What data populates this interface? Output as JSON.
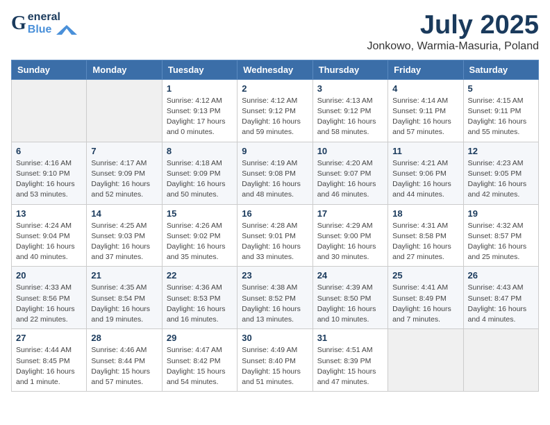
{
  "header": {
    "logo_g": "G",
    "logo_eneral": "eneral",
    "logo_blue": "Blue",
    "month_title": "July 2025",
    "subtitle": "Jonkowo, Warmia-Masuria, Poland"
  },
  "weekdays": [
    "Sunday",
    "Monday",
    "Tuesday",
    "Wednesday",
    "Thursday",
    "Friday",
    "Saturday"
  ],
  "weeks": [
    [
      {
        "day": "",
        "info": ""
      },
      {
        "day": "",
        "info": ""
      },
      {
        "day": "1",
        "info": "Sunrise: 4:12 AM\nSunset: 9:13 PM\nDaylight: 17 hours\nand 0 minutes."
      },
      {
        "day": "2",
        "info": "Sunrise: 4:12 AM\nSunset: 9:12 PM\nDaylight: 16 hours\nand 59 minutes."
      },
      {
        "day": "3",
        "info": "Sunrise: 4:13 AM\nSunset: 9:12 PM\nDaylight: 16 hours\nand 58 minutes."
      },
      {
        "day": "4",
        "info": "Sunrise: 4:14 AM\nSunset: 9:11 PM\nDaylight: 16 hours\nand 57 minutes."
      },
      {
        "day": "5",
        "info": "Sunrise: 4:15 AM\nSunset: 9:11 PM\nDaylight: 16 hours\nand 55 minutes."
      }
    ],
    [
      {
        "day": "6",
        "info": "Sunrise: 4:16 AM\nSunset: 9:10 PM\nDaylight: 16 hours\nand 53 minutes."
      },
      {
        "day": "7",
        "info": "Sunrise: 4:17 AM\nSunset: 9:09 PM\nDaylight: 16 hours\nand 52 minutes."
      },
      {
        "day": "8",
        "info": "Sunrise: 4:18 AM\nSunset: 9:09 PM\nDaylight: 16 hours\nand 50 minutes."
      },
      {
        "day": "9",
        "info": "Sunrise: 4:19 AM\nSunset: 9:08 PM\nDaylight: 16 hours\nand 48 minutes."
      },
      {
        "day": "10",
        "info": "Sunrise: 4:20 AM\nSunset: 9:07 PM\nDaylight: 16 hours\nand 46 minutes."
      },
      {
        "day": "11",
        "info": "Sunrise: 4:21 AM\nSunset: 9:06 PM\nDaylight: 16 hours\nand 44 minutes."
      },
      {
        "day": "12",
        "info": "Sunrise: 4:23 AM\nSunset: 9:05 PM\nDaylight: 16 hours\nand 42 minutes."
      }
    ],
    [
      {
        "day": "13",
        "info": "Sunrise: 4:24 AM\nSunset: 9:04 PM\nDaylight: 16 hours\nand 40 minutes."
      },
      {
        "day": "14",
        "info": "Sunrise: 4:25 AM\nSunset: 9:03 PM\nDaylight: 16 hours\nand 37 minutes."
      },
      {
        "day": "15",
        "info": "Sunrise: 4:26 AM\nSunset: 9:02 PM\nDaylight: 16 hours\nand 35 minutes."
      },
      {
        "day": "16",
        "info": "Sunrise: 4:28 AM\nSunset: 9:01 PM\nDaylight: 16 hours\nand 33 minutes."
      },
      {
        "day": "17",
        "info": "Sunrise: 4:29 AM\nSunset: 9:00 PM\nDaylight: 16 hours\nand 30 minutes."
      },
      {
        "day": "18",
        "info": "Sunrise: 4:31 AM\nSunset: 8:58 PM\nDaylight: 16 hours\nand 27 minutes."
      },
      {
        "day": "19",
        "info": "Sunrise: 4:32 AM\nSunset: 8:57 PM\nDaylight: 16 hours\nand 25 minutes."
      }
    ],
    [
      {
        "day": "20",
        "info": "Sunrise: 4:33 AM\nSunset: 8:56 PM\nDaylight: 16 hours\nand 22 minutes."
      },
      {
        "day": "21",
        "info": "Sunrise: 4:35 AM\nSunset: 8:54 PM\nDaylight: 16 hours\nand 19 minutes."
      },
      {
        "day": "22",
        "info": "Sunrise: 4:36 AM\nSunset: 8:53 PM\nDaylight: 16 hours\nand 16 minutes."
      },
      {
        "day": "23",
        "info": "Sunrise: 4:38 AM\nSunset: 8:52 PM\nDaylight: 16 hours\nand 13 minutes."
      },
      {
        "day": "24",
        "info": "Sunrise: 4:39 AM\nSunset: 8:50 PM\nDaylight: 16 hours\nand 10 minutes."
      },
      {
        "day": "25",
        "info": "Sunrise: 4:41 AM\nSunset: 8:49 PM\nDaylight: 16 hours\nand 7 minutes."
      },
      {
        "day": "26",
        "info": "Sunrise: 4:43 AM\nSunset: 8:47 PM\nDaylight: 16 hours\nand 4 minutes."
      }
    ],
    [
      {
        "day": "27",
        "info": "Sunrise: 4:44 AM\nSunset: 8:45 PM\nDaylight: 16 hours\nand 1 minute."
      },
      {
        "day": "28",
        "info": "Sunrise: 4:46 AM\nSunset: 8:44 PM\nDaylight: 15 hours\nand 57 minutes."
      },
      {
        "day": "29",
        "info": "Sunrise: 4:47 AM\nSunset: 8:42 PM\nDaylight: 15 hours\nand 54 minutes."
      },
      {
        "day": "30",
        "info": "Sunrise: 4:49 AM\nSunset: 8:40 PM\nDaylight: 15 hours\nand 51 minutes."
      },
      {
        "day": "31",
        "info": "Sunrise: 4:51 AM\nSunset: 8:39 PM\nDaylight: 15 hours\nand 47 minutes."
      },
      {
        "day": "",
        "info": ""
      },
      {
        "day": "",
        "info": ""
      }
    ]
  ]
}
